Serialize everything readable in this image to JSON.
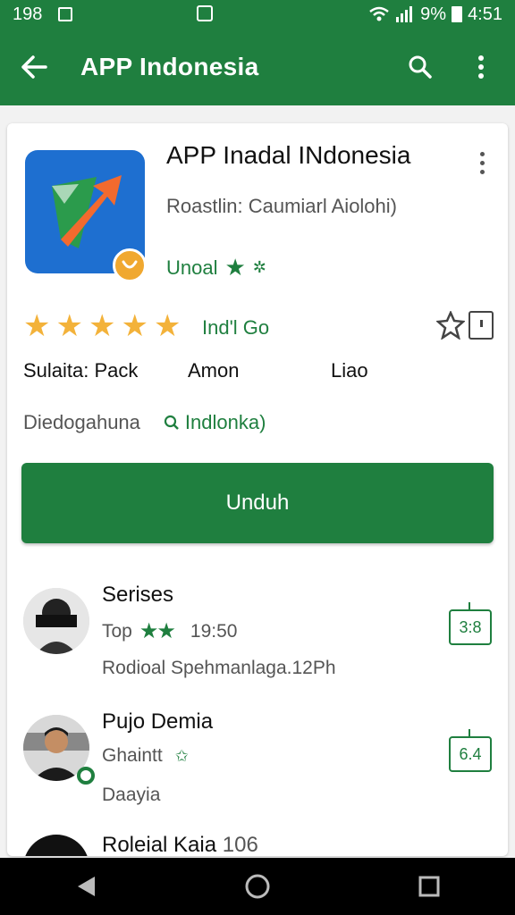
{
  "status_bar": {
    "time_left": "198",
    "battery_text": "9%",
    "clock": "4:51"
  },
  "app_bar": {
    "title": "APP Indonesia"
  },
  "app": {
    "title": "APP Inadal INdonesia",
    "developer": "Roastlin: Caumiarl Aiolohi)",
    "tag": "Unoal",
    "rating_label": "Ind'l Go",
    "stars": 5,
    "info": [
      "Sulaita: Pack",
      "Amon",
      "Liao"
    ],
    "description": "Diedogahuna",
    "region_link": "Indlonka)"
  },
  "install_label": "Unduh",
  "list": [
    {
      "title": "Serises",
      "meta": "Top",
      "time": "19:50",
      "sub": "Rodioal Spehmanlaga.12Ph",
      "badge": "3:8"
    },
    {
      "title": "Pujo Demia",
      "meta": "Ghaintt",
      "sub": "Daayia",
      "badge": "6.4"
    },
    {
      "title": "Roleial Kaia",
      "meta": "106"
    }
  ],
  "colors": {
    "primary": "#1f7f3f",
    "star": "#f3b23a",
    "app_icon_bg": "#1e6fd0"
  }
}
